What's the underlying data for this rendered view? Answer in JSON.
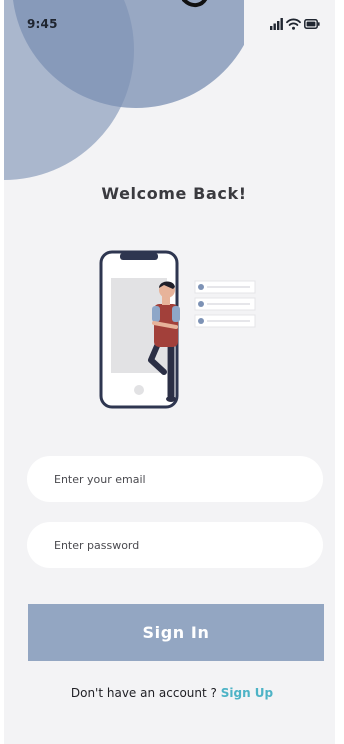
{
  "status_bar": {
    "time": "9:45",
    "icons": [
      "signal-icon",
      "wifi-icon",
      "battery-icon"
    ]
  },
  "login": {
    "title": "Welcome Back!",
    "email_placeholder": "Enter your email",
    "password_placeholder": "Enter password",
    "sign_in_label": "Sign In",
    "no_account_text": "Don't have an account ?",
    "sign_up_label": "Sign Up"
  },
  "colors": {
    "background": "#f3f3f5",
    "accent_circle_dark": "#7a90b4",
    "accent_circle_light": "#a5b4cc",
    "button": "#93a6c2",
    "button_text": "#ffffff",
    "link": "#4db3c6",
    "input_background": "#ffffff"
  }
}
